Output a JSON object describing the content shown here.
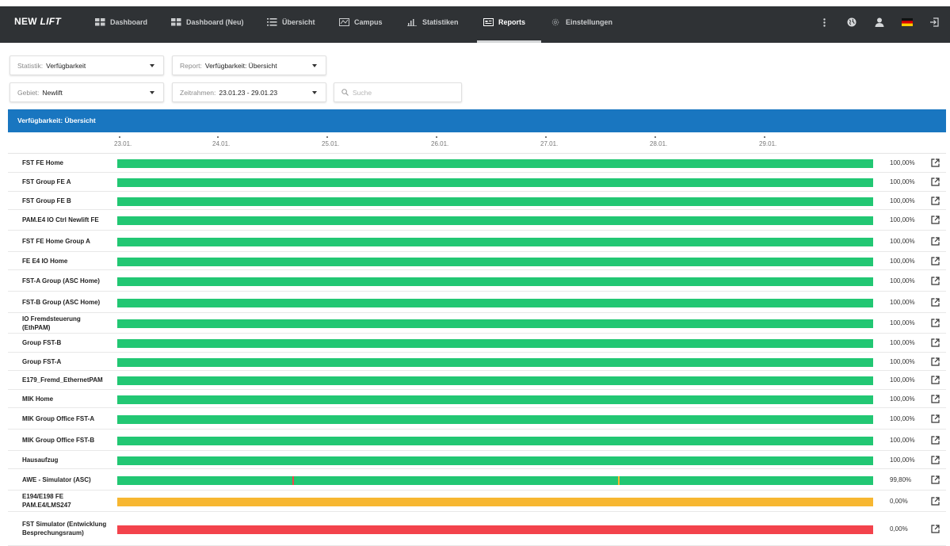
{
  "brand": {
    "prefix": "NEW ",
    "suffix": "LIFT"
  },
  "nav": [
    {
      "label": "Dashboard",
      "icon": "grid-icon"
    },
    {
      "label": "Dashboard (Neu)",
      "icon": "grid-icon"
    },
    {
      "label": "Übersicht",
      "icon": "list-icon"
    },
    {
      "label": "Campus",
      "icon": "map-icon"
    },
    {
      "label": "Statistiken",
      "icon": "bar-chart-icon"
    },
    {
      "label": "Reports",
      "icon": "report-icon",
      "active": true
    },
    {
      "label": "Einstellungen",
      "icon": "gear-icon"
    }
  ],
  "nav_right": [
    "more-vertical-icon",
    "globe-icon",
    "user-icon",
    "german-flag-icon",
    "logout-icon"
  ],
  "filters": {
    "statistik": {
      "label": "Statistik:",
      "value": "Verfügbarkeit"
    },
    "report": {
      "label": "Report:",
      "value": "Verfügbarkeit: Übersicht"
    },
    "gebiet": {
      "label": "Gebiet:",
      "value": "Newlift"
    },
    "zeitrahmen": {
      "label": "Zeitrahmen:",
      "value": "23.01.23 - 29.01.23"
    },
    "search_placeholder": "Suche"
  },
  "report_title": "Verfügbarkeit: Übersicht",
  "timeline_ticks": [
    "23.01.",
    "24.01.",
    "25.01.",
    "26.01.",
    "27.01.",
    "28.01.",
    "29.01."
  ],
  "colors": {
    "nav_bg": "#2f3235",
    "header_blue": "#1976c0",
    "ok_green": "#22c773",
    "warn_orange": "#f7b731",
    "error_red": "#f3434c"
  },
  "rows": [
    {
      "name": "FST FE Home",
      "percent": "100,00%",
      "status": "green"
    },
    {
      "name": "FST Group FE A",
      "percent": "100,00%",
      "status": "green"
    },
    {
      "name": "FST Group FE B",
      "percent": "100,00%",
      "status": "green"
    },
    {
      "name": "PAM.E4 IO Ctrl Newlift FE",
      "percent": "100,00%",
      "status": "green"
    },
    {
      "name": "FST FE Home Group A",
      "percent": "100,00%",
      "status": "green"
    },
    {
      "name": "FE E4 IO Home",
      "percent": "100,00%",
      "status": "green"
    },
    {
      "name": "FST-A Group (ASC Home)",
      "percent": "100,00%",
      "status": "green"
    },
    {
      "name": "FST-B Group (ASC Home)",
      "percent": "100,00%",
      "status": "green"
    },
    {
      "name": "IO Fremdsteuerung (EthPAM)",
      "percent": "100,00%",
      "status": "green"
    },
    {
      "name": "Group FST-B",
      "percent": "100,00%",
      "status": "green"
    },
    {
      "name": "Group FST-A",
      "percent": "100,00%",
      "status": "green"
    },
    {
      "name": "E179_Fremd_EthernetPAM",
      "percent": "100,00%",
      "status": "green"
    },
    {
      "name": "MIK Home",
      "percent": "100,00%",
      "status": "green"
    },
    {
      "name": "MIK Group Office FST-A",
      "percent": "100,00%",
      "status": "green"
    },
    {
      "name": "MIK Group Office FST-B",
      "percent": "100,00%",
      "status": "green"
    },
    {
      "name": "Hausaufzug",
      "percent": "100,00%",
      "status": "green"
    },
    {
      "name": "AWE - Simulator (ASC)",
      "percent": "99,80%",
      "status": "green",
      "events": [
        {
          "at": 0.232,
          "color": "#f3434c"
        },
        {
          "at": 0.662,
          "color": "#f7b731"
        }
      ]
    },
    {
      "name": "E194/E198 FE PAM.E4/LMS247",
      "percent": "0,00%",
      "status": "orange"
    },
    {
      "name": "FST Simulator (Entwicklung Besprechungsraum)",
      "percent": "0,00%",
      "status": "red"
    }
  ]
}
